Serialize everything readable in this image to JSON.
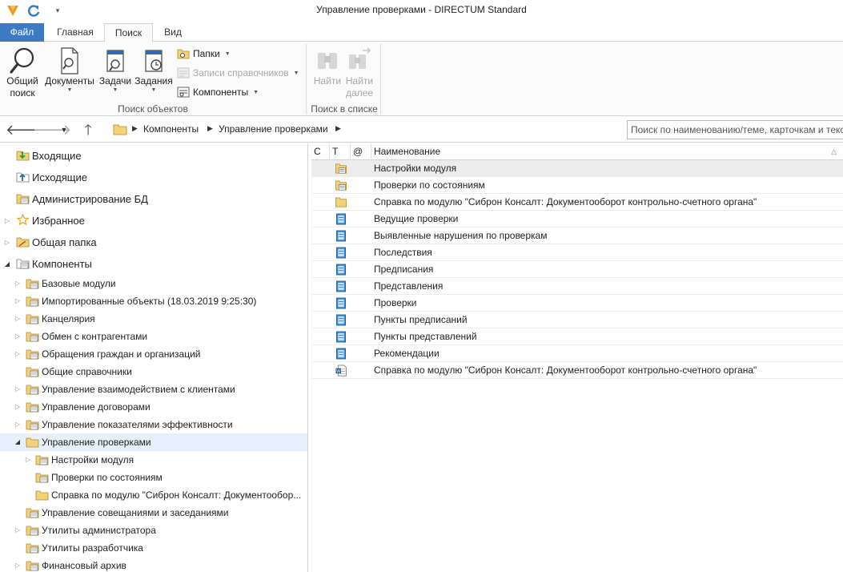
{
  "window": {
    "title": "Управление проверками - DIRECTUM Standard"
  },
  "ribbon_tabs": [
    {
      "label": "Файл"
    },
    {
      "label": "Главная"
    },
    {
      "label": "Поиск"
    },
    {
      "label": "Вид"
    }
  ],
  "ribbon": {
    "search_objects": {
      "general_search": "Общий",
      "general_search_2": "поиск",
      "documents": "Документы",
      "tasks": "Задачи",
      "assignments": "Задания",
      "folders": "Папки",
      "directory_records": "Записи справочников",
      "components": "Компоненты",
      "group_label": "Поиск объектов"
    },
    "search_in_list": {
      "find": "Найти",
      "find_next": "Найти",
      "find_next_2": "далее",
      "group_label": "Поиск в списке"
    }
  },
  "address": {
    "crumbs": [
      "Компоненты",
      "Управление проверками"
    ],
    "search_placeholder": "Поиск по наименованию/теме, карточкам и тексту"
  },
  "tree": {
    "top": [
      {
        "label": "Входящие"
      },
      {
        "label": "Исходящие"
      },
      {
        "label": "Администрирование БД"
      },
      {
        "label": "Избранное"
      },
      {
        "label": "Общая папка"
      },
      {
        "label": "Компоненты"
      }
    ],
    "components": [
      {
        "label": "Базовые модули"
      },
      {
        "label": "Импортированные объекты (18.03.2019 9:25:30)"
      },
      {
        "label": "Канцелярия"
      },
      {
        "label": "Обмен с контрагентами"
      },
      {
        "label": "Обращения граждан и организаций"
      },
      {
        "label": "Общие справочники"
      },
      {
        "label": "Управление взаимодействием с клиентами"
      },
      {
        "label": "Управление договорами"
      },
      {
        "label": "Управление показателями эффективности"
      },
      {
        "label": "Управление проверками"
      }
    ],
    "checks_children": [
      {
        "label": "Настройки модуля"
      },
      {
        "label": "Проверки по состояниям"
      },
      {
        "label": "Справка по модулю \"Сиброн Консалт: Документообор..."
      }
    ],
    "after": [
      {
        "label": "Управление совещаниями и заседаниями"
      },
      {
        "label": "Утилиты администратора"
      },
      {
        "label": "Утилиты разработчика"
      },
      {
        "label": "Финансовый архив"
      }
    ]
  },
  "list": {
    "columns": {
      "c": "С",
      "t": "Т",
      "at": "@",
      "name": "Наименование"
    },
    "rows": [
      {
        "name": "Настройки модуля",
        "icon": "folder-list-icon"
      },
      {
        "name": "Проверки по состояниям",
        "icon": "folder-list-icon"
      },
      {
        "name": "Справка по модулю \"Сиброн Консалт: Документооборот контрольно-счетного органа\"",
        "icon": "folder-icon"
      },
      {
        "name": "Ведущие проверки",
        "icon": "reference-book-icon"
      },
      {
        "name": "Выявленные нарушения по проверкам",
        "icon": "reference-book-icon"
      },
      {
        "name": "Последствия",
        "icon": "reference-book-icon"
      },
      {
        "name": "Предписания",
        "icon": "reference-book-icon"
      },
      {
        "name": "Представления",
        "icon": "reference-book-icon"
      },
      {
        "name": "Проверки",
        "icon": "reference-book-icon"
      },
      {
        "name": "Пункты предписаний",
        "icon": "reference-book-icon"
      },
      {
        "name": "Пункты представлений",
        "icon": "reference-book-icon"
      },
      {
        "name": "Рекомендации",
        "icon": "reference-book-icon"
      },
      {
        "name": "Справка по модулю \"Сиброн Консалт: Документооборот контрольно-счетного органа\"",
        "icon": "word-document-icon"
      }
    ]
  },
  "colors": {
    "accent": "#3c7bc4",
    "selection": "#e5f0fb",
    "folder": "#f3d27a"
  }
}
